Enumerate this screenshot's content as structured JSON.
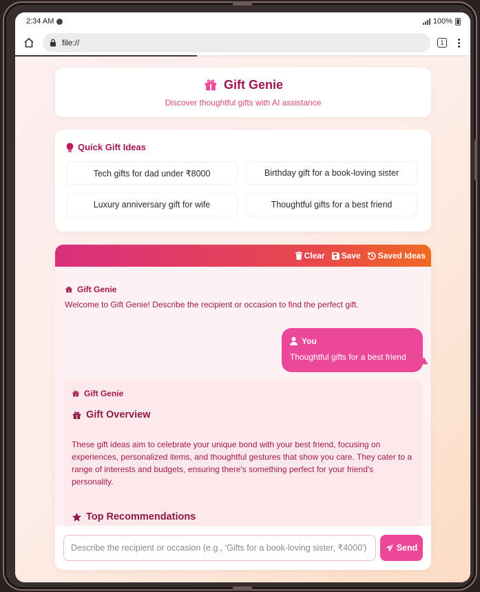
{
  "status_bar": {
    "time": "2:34 AM",
    "battery": "100%"
  },
  "browser": {
    "url": "file://",
    "tab_count": "1"
  },
  "header": {
    "title": "Gift Genie",
    "subtitle": "Discover thoughtful gifts with AI assistance",
    "icon": "gift-icon"
  },
  "quick_ideas": {
    "title": "Quick Gift Ideas",
    "icon": "lightbulb-icon",
    "items": [
      "Tech gifts for dad under ₹8000",
      "Birthday gift for a book-loving sister",
      "Luxury anniversary gift for wife",
      "Thoughtful gifts for a best friend"
    ]
  },
  "chat": {
    "toolbar": {
      "clear": "Clear",
      "save": "Save",
      "saved_ideas": "Saved Ideas"
    },
    "bot_name": "Gift Genie",
    "user_name": "You",
    "messages": {
      "welcome": "Welcome to Gift Genie! Describe the recipient or occasion to find the perfect gift.",
      "user": "Thoughtful gifts for a best friend",
      "overview_title": "Gift Overview",
      "overview_text": "These gift ideas aim to celebrate your unique bond with your best friend, focusing on experiences, personalized items, and thoughtful gestures that show you care. They cater to a range of interests and budgets, ensuring there's something perfect for your friend's personality.",
      "recommendations_title": "Top Recommendations"
    },
    "input_placeholder": "Describe the recipient or occasion (e.g., 'Gifts for a book-loving sister, ₹4000')",
    "send_label": "Send"
  },
  "colors": {
    "primary": "#ec4899",
    "heading": "#a1174d",
    "toolbar_start": "#d92f7e",
    "toolbar_end": "#f06a22"
  }
}
